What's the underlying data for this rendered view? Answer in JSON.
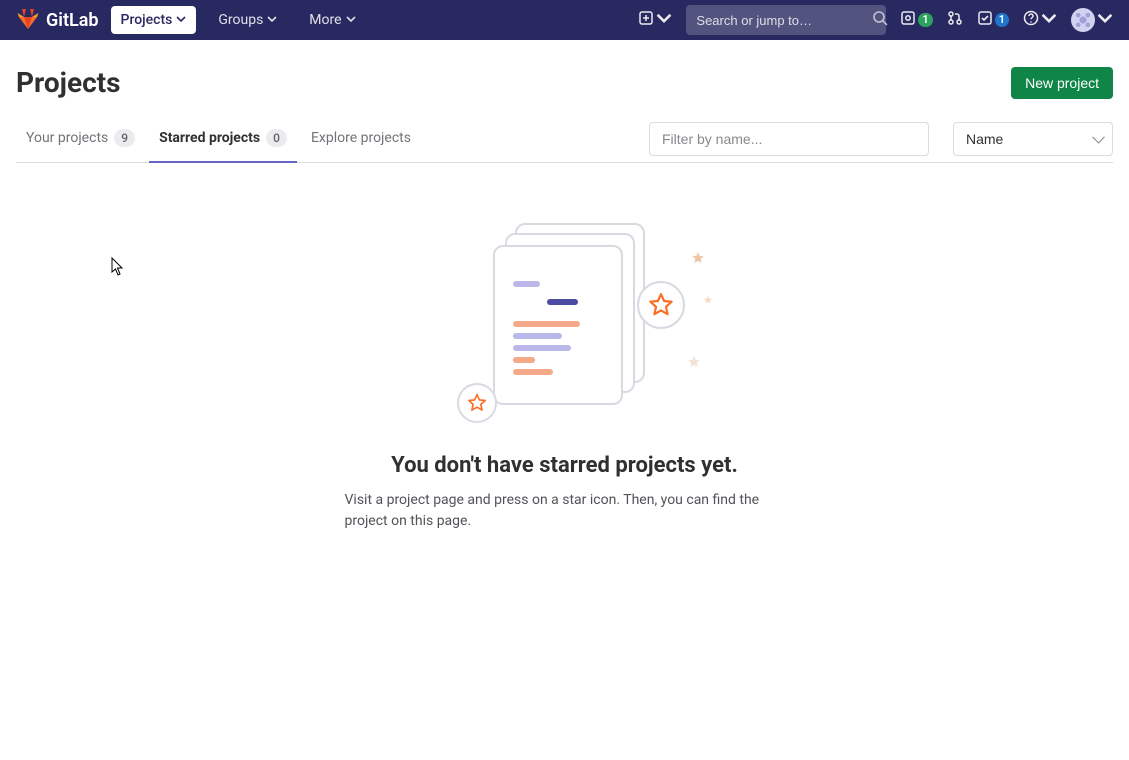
{
  "brand": "GitLab",
  "nav": {
    "projects": "Projects",
    "groups": "Groups",
    "more": "More"
  },
  "search_placeholder": "Search or jump to…",
  "counts": {
    "issues": "1",
    "merge_requests": "",
    "todos": "1"
  },
  "page_title": "Projects",
  "new_project_label": "New project",
  "tabs": {
    "your_projects": {
      "label": "Your projects",
      "count": "9"
    },
    "starred_projects": {
      "label": "Starred projects",
      "count": "0"
    },
    "explore_projects": {
      "label": "Explore projects"
    }
  },
  "filter_placeholder": "Filter by name...",
  "sort_selected": "Name",
  "empty": {
    "title": "You don't have starred projects yet.",
    "description": "Visit a project page and press on a star icon. Then, you can find the project on this page."
  }
}
